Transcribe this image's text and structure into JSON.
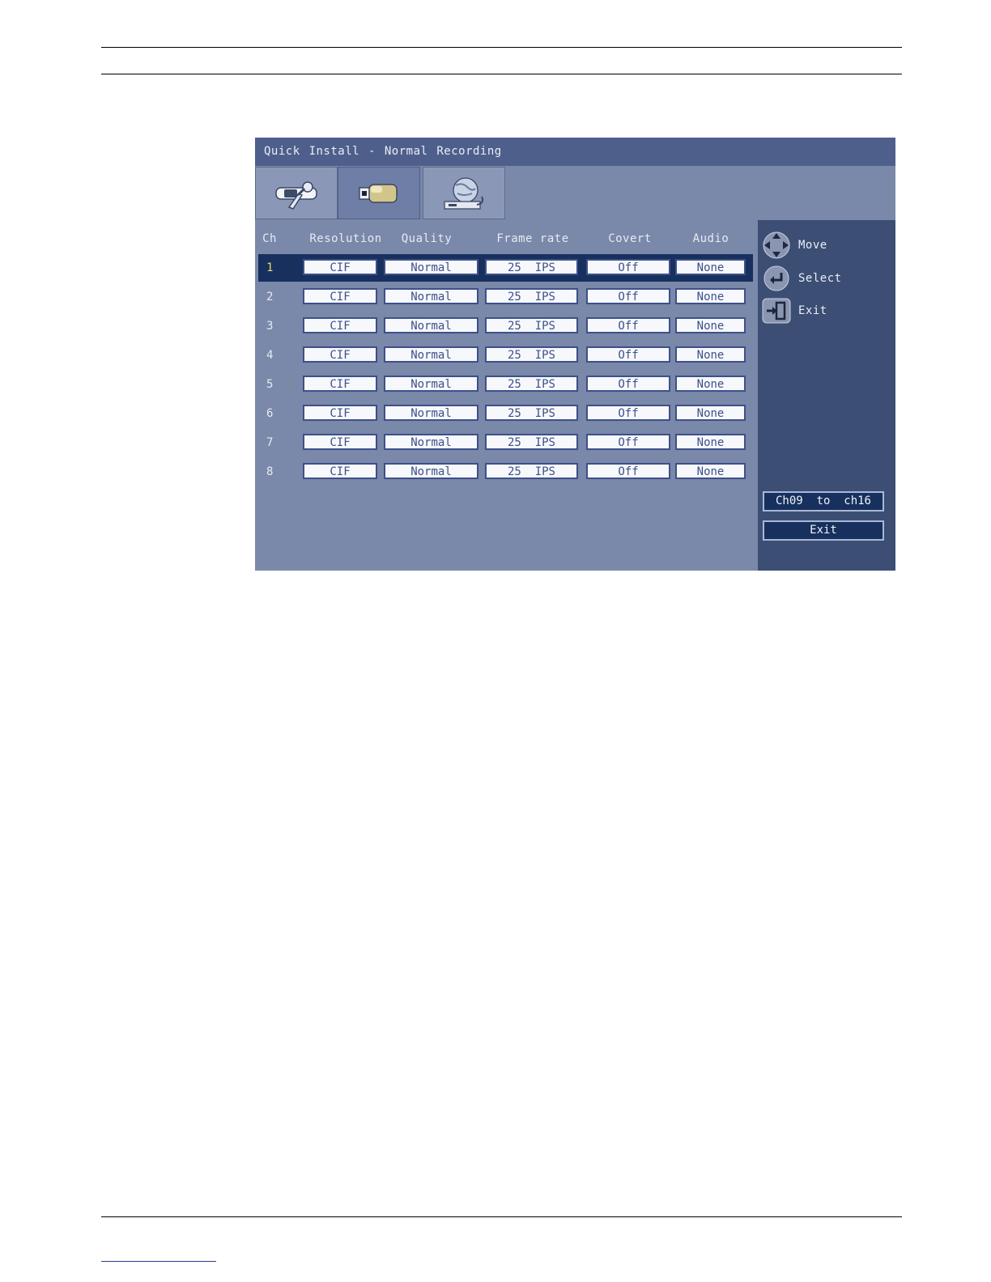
{
  "window": {
    "title": "Quick Install - Normal Recording"
  },
  "tabs": [
    {
      "icon": "tools-icon"
    },
    {
      "icon": "camera-icon"
    },
    {
      "icon": "network-icon"
    }
  ],
  "table": {
    "headers": [
      "Ch",
      "Resolution",
      "Quality",
      "Frame rate",
      "Covert",
      "Audio"
    ],
    "rows": [
      {
        "ch": "1",
        "resolution": "CIF",
        "quality": "Normal",
        "frame_rate": "25  IPS",
        "covert": "Off",
        "audio": "None",
        "selected": true
      },
      {
        "ch": "2",
        "resolution": "CIF",
        "quality": "Normal",
        "frame_rate": "25  IPS",
        "covert": "Off",
        "audio": "None"
      },
      {
        "ch": "3",
        "resolution": "CIF",
        "quality": "Normal",
        "frame_rate": "25  IPS",
        "covert": "Off",
        "audio": "None"
      },
      {
        "ch": "4",
        "resolution": "CIF",
        "quality": "Normal",
        "frame_rate": "25  IPS",
        "covert": "Off",
        "audio": "None"
      },
      {
        "ch": "5",
        "resolution": "CIF",
        "quality": "Normal",
        "frame_rate": "25  IPS",
        "covert": "Off",
        "audio": "None"
      },
      {
        "ch": "6",
        "resolution": "CIF",
        "quality": "Normal",
        "frame_rate": "25  IPS",
        "covert": "Off",
        "audio": "None"
      },
      {
        "ch": "7",
        "resolution": "CIF",
        "quality": "Normal",
        "frame_rate": "25  IPS",
        "covert": "Off",
        "audio": "None"
      },
      {
        "ch": "8",
        "resolution": "CIF",
        "quality": "Normal",
        "frame_rate": "25  IPS",
        "covert": "Off",
        "audio": "None"
      }
    ]
  },
  "sidebar": {
    "legend": [
      {
        "icon": "dpad-icon",
        "label": "Move"
      },
      {
        "icon": "enter-icon",
        "label": "Select"
      },
      {
        "icon": "exit-icon",
        "label": "Exit"
      }
    ],
    "buttons": {
      "next_channels": "Ch09  to  ch16",
      "exit": "Exit"
    }
  },
  "colors": {
    "panel": "#7a88a9",
    "titlebar": "#4f5f8b",
    "sidebar": "#3c4e74",
    "selected_row": "#18305e",
    "field_border": "#3d5089",
    "selected_channel": "#f0d86a"
  }
}
